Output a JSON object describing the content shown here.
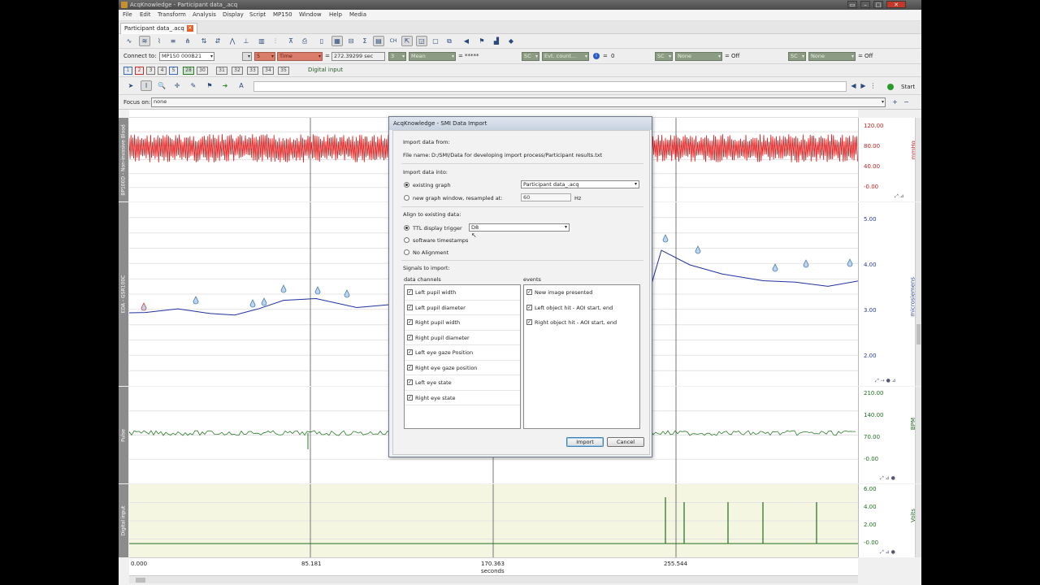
{
  "window": {
    "title": "AcqKnowledge - Participant data_.acq"
  },
  "menu": [
    "File",
    "Edit",
    "Transform",
    "Analysis",
    "Display",
    "Script",
    "MP150",
    "Window",
    "Help",
    "Media"
  ],
  "tab": {
    "label": "Participant data_.acq"
  },
  "connect": {
    "label": "Connect to:",
    "device": "MP150 000B21",
    "channel_num": "5",
    "mode": "Time",
    "time_value": "272.39299 sec",
    "m2_num": "3",
    "m2_func": "Mean",
    "m2_value": "*****",
    "m3_chan": "SC",
    "m3_func": "Evt. count...",
    "m3_value": "0",
    "m4_chan": "SC",
    "m4_func": "None",
    "m4_value": "Off",
    "m5_chan": "SC",
    "m5_func": "None",
    "m5_value": "Off",
    "eq": "="
  },
  "channels_bar": {
    "buttons": [
      "1",
      "2",
      "3",
      "4",
      "5",
      "28",
      "30",
      "31",
      "32",
      "33",
      "34",
      "35"
    ],
    "digital_label": "Digital input"
  },
  "run": {
    "start_label": "Start"
  },
  "focus": {
    "label": "Focus on:",
    "value": "none"
  },
  "strips": [
    {
      "label": "BP100D - Non-invasive Blood",
      "unit": "mmHg",
      "ticks": [
        "120.00",
        "80.00",
        "40.00",
        "-0.00"
      ]
    },
    {
      "label": "EDA - GSR100C",
      "unit": "microsiemens",
      "ticks": [
        "5.00",
        "4.00",
        "3.00",
        "2.00"
      ]
    },
    {
      "label": "Pulse",
      "unit": "BPM",
      "ticks": [
        "210.00",
        "140.00",
        "70.00",
        "-0.00"
      ]
    },
    {
      "label": "Digital input",
      "unit": "Volts",
      "ticks": [
        "6.00",
        "4.00",
        "2.00",
        "-0.00"
      ]
    }
  ],
  "xaxis": {
    "ticks": [
      "0.000",
      "85.181",
      "170.363",
      "255.544"
    ],
    "unit": "seconds"
  },
  "dialog": {
    "title": "AcqKnowledge - SMI Data Import",
    "import_from_heading": "Import data from:",
    "file_label": "File name:",
    "file_path": "D:/SMI/Data for developing import process/Participant results.txt",
    "import_into_heading": "Import data into:",
    "existing_graph_label": "existing graph",
    "existing_graph_value": "Participant data_.acq",
    "new_window_label": "new graph window, resampled at:",
    "resample_value": "60",
    "resample_unit": "Hz",
    "align_heading": "Align to existing data:",
    "ttl_label": "TTL display trigger",
    "ttl_value": "D8",
    "software_ts_label": "software timestamps",
    "no_align_label": "No Alignment",
    "signals_heading": "Signals to import:",
    "data_channels_heading": "data channels",
    "events_heading": "events",
    "data_channels": [
      "Left pupil width",
      "Left pupil diameter",
      "Right pupil width",
      "Right pupil diameter",
      "Left eye gaze Position",
      "Right eye gaze position",
      "Left eye state",
      "Right eye state"
    ],
    "events": [
      "New image presented",
      "Left object hit - AOI start, end",
      "Right object hit - AOI start, end"
    ],
    "import_button": "Import",
    "cancel_button": "Cancel"
  },
  "colors": {
    "bp_trace": "#e01818",
    "eda_trace": "#2030a0",
    "pulse_trace": "#2a7a2a",
    "digital_trace": "#1e6e1e",
    "digital_bg": "#f4f6e2"
  }
}
